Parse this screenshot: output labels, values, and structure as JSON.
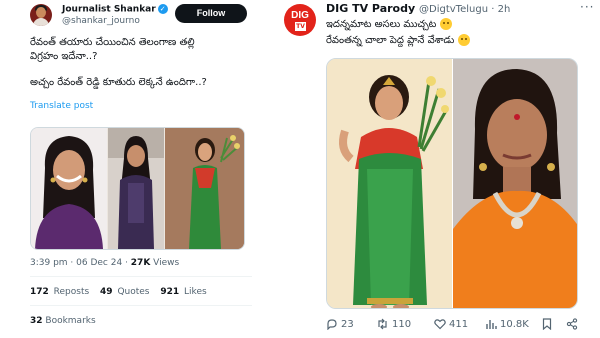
{
  "left_tweet": {
    "author": {
      "name": "Journalist Shankar",
      "handle": "@shankar_journo",
      "verified_icon": "verified-badge-icon"
    },
    "follow_label": "Follow",
    "text_line1": "రేవంత్ తయారు చేయించిన తెలంగాణ తల్లి",
    "text_line2": "విగ్రహం ఇదేనా..?",
    "text_line3": "అచ్చం రేవంత్ రెడ్డి కూతురు లెక్కనే ఉందిగా..?",
    "translate_label": "Translate post",
    "meta": {
      "time": "3:39 pm",
      "sep": " · ",
      "date": "06 Dec 24",
      "sep2": " · ",
      "views": "27K",
      "views_label": " Views"
    },
    "stats": {
      "reposts": "172",
      "reposts_label": " Reposts",
      "quotes": "49",
      "quotes_label": " Quotes",
      "likes": "921",
      "likes_label": " Likes"
    },
    "bookmarks": {
      "count": "32",
      "label": " Bookmarks"
    }
  },
  "right_tweet": {
    "author": {
      "name": "DIG TV Parody",
      "handle": "@DigtvTelugu",
      "sep": " · ",
      "time": "2h"
    },
    "avatar": {
      "logo_text": "DIG",
      "logo_sub": "TV"
    },
    "text_line1": "ఇదన్నమాట అసలు ముచ్చట",
    "text_line2": "రేవంతన్న చాలా పెద్ద ప్లానే వేశాడు",
    "actions": {
      "replies": "23",
      "reposts": "110",
      "likes": "411",
      "views": "10.8K"
    }
  },
  "colors": {
    "accent": "#1d9bf0",
    "text": "#0f1419",
    "muted": "#536471",
    "dig_red": "#e2231a"
  }
}
